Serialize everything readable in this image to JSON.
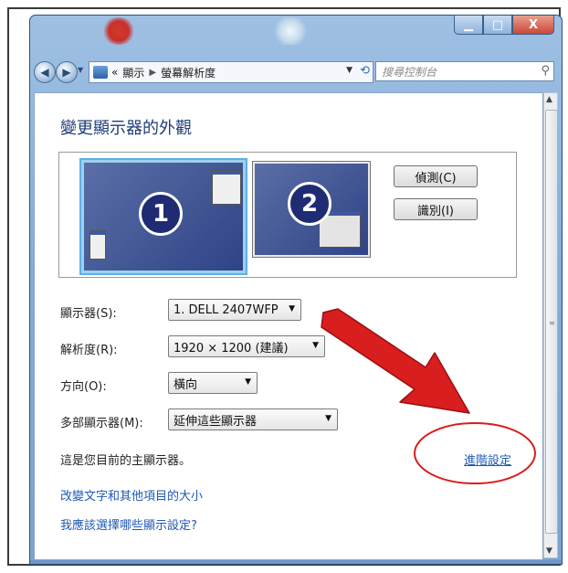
{
  "window": {
    "min_symbol": "▁",
    "max_symbol": "□",
    "close_symbol": "X"
  },
  "address": {
    "back_icon": "back-arrow-icon",
    "forward_icon": "forward-arrow-icon",
    "overflow": "«",
    "crumbs": [
      "顯示",
      "螢幕解析度"
    ],
    "search_placeholder": "搜尋控制台"
  },
  "page": {
    "title": "變更顯示器的外觀",
    "monitors": [
      {
        "number": "1",
        "selected": true
      },
      {
        "number": "2",
        "selected": false
      }
    ],
    "buttons": {
      "detect": "偵測(C)",
      "identify": "識別(I)"
    },
    "fields": [
      {
        "label": "顯示器(S):",
        "value": "1. DELL 2407WFP"
      },
      {
        "label": "解析度(R):",
        "value": "1920 × 1200 (建議)"
      },
      {
        "label": "方向(O):",
        "value": "橫向"
      },
      {
        "label": "多部顯示器(M):",
        "value": "延伸這些顯示器"
      }
    ],
    "status": "這是您目前的主顯示器。",
    "advanced_link": "進階設定",
    "links": [
      "改變文字和其他項目的大小",
      "我應該選擇哪些顯示設定?"
    ]
  },
  "colors": {
    "link": "#1f58b5",
    "title": "#1e3c78",
    "annotation_red": "#d81e1e",
    "selected_monitor_border": "#9fd0ef"
  }
}
